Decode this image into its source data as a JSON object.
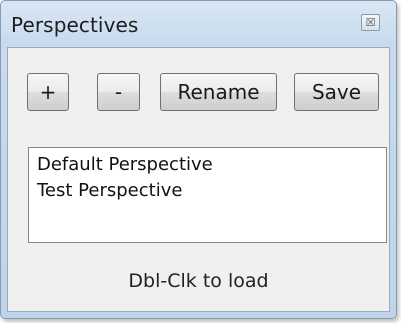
{
  "window": {
    "title": "Perspectives",
    "close_glyph": "☒"
  },
  "toolbar": {
    "add_label": "+",
    "remove_label": "-",
    "rename_label": "Rename",
    "save_label": "Save"
  },
  "perspectives": {
    "items": [
      "Default Perspective",
      "Test Perspective"
    ]
  },
  "hint": "Dbl-Clk to load"
}
